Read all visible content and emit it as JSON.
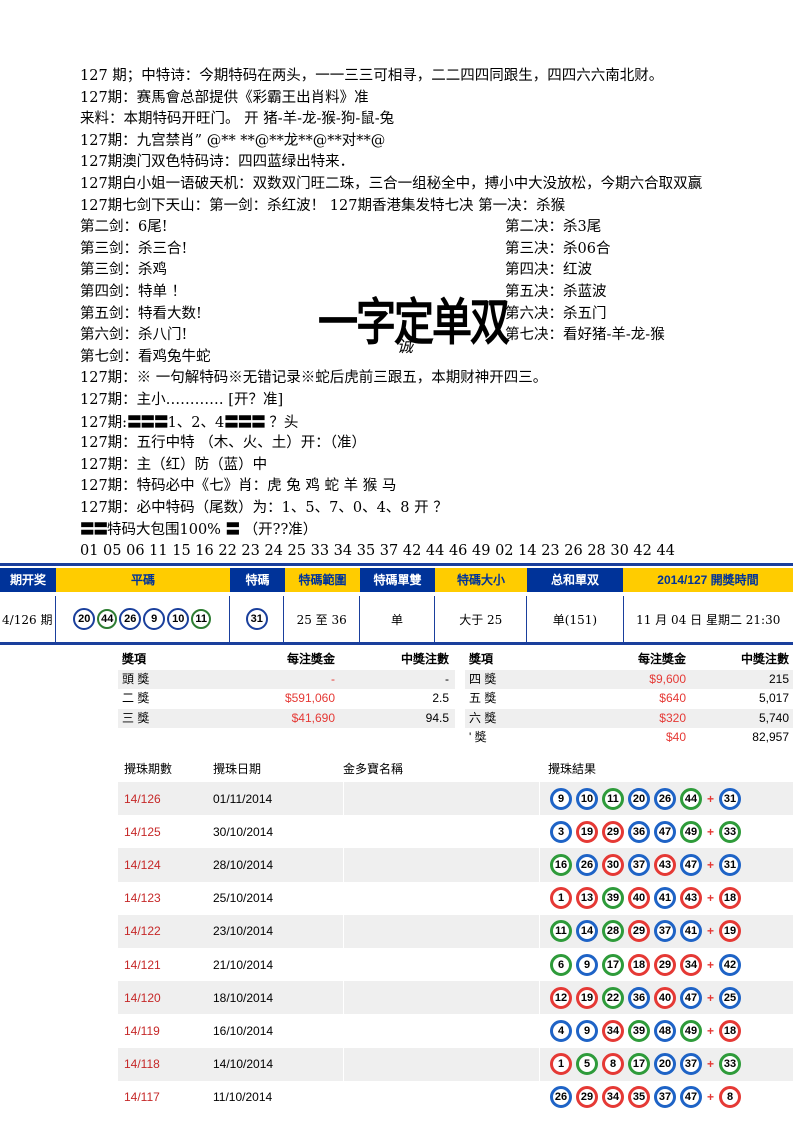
{
  "text_lines": {
    "l1": "127 期；中特诗：今期特码在两头，一一三三可相寻，二二四四同跟生，四四六六南北财。",
    "l2": "127期：赛馬會总部提供《彩霸王出肖料》准",
    "l3": "来料：本期特码开旺门。         开 猪-羊-龙-猴-狗-鼠-兔",
    "l4": "127期：九宫禁肖”  @** **@**龙**@**对**@",
    "l5": "127期澳门双色特码诗：四四蓝绿出特来．",
    "l6": "127期白小姐一语破天机：双数双门旺二珠，三合一组秘全中，搏小中大没放松，今期六合取双赢",
    "l7": "127期七剑下天山：第一剑：杀红波！        127期香港集发特七决  第一决：杀猴",
    "pairs": [
      {
        "left": "第二剑：6尾!",
        "right": "第二决：杀3尾"
      },
      {
        "left": "第三剑：杀三合!",
        "right": "第三决：杀06合"
      },
      {
        "left": "第三剑：杀鸡",
        "right": "第四决：红波"
      },
      {
        "left": "第四剑：特单 ！",
        "right": "第五决：杀蓝波"
      },
      {
        "left": "第五剑：特看大数!",
        "right": "第六决：杀五门"
      },
      {
        "left": "第六剑：杀八门!",
        "right": "第七决：看好猪-羊-龙-猴"
      }
    ],
    "l8": "第七剑：看鸡兔牛蛇",
    "l9": "127期：※ 一句解特码※无错记录※蛇后虎前三跟五，本期财神开四三。",
    "l10": "127期：主小………… [开？准]",
    "l11a": "127期:",
    "l11bars1": "〓〓〓",
    "l11b": "1、2、4",
    "l11bars2": "〓〓〓",
    "l11c": " ？头",
    "l12": "127期：五行中特   （木、火、土）开：（准）",
    "l13": "127期：主（红）防（蓝）中",
    "l14": "127期：特码必中《七》肖：虎 兔 鸡 蛇 羊 猴 马",
    "l15": "127期：必中特码（尾数）为：1、5、7、0、4、8      开 ？",
    "l16bars1": "〓〓",
    "l16a": "特码大包围100%  ",
    "l16bars2": "〓",
    "l16b": "   （开??准）",
    "l17": "01 05 06 11 15 16 22 23 24 25 33 34 35 37 42 44 46 49 02 14 23 26 28 30 42 44"
  },
  "stamp": {
    "text": "一字定单双",
    "sig": "诚"
  },
  "result_header": [
    "期开奖",
    "平碼",
    "特碼",
    "特碼範圍",
    "特碼單雙",
    "特碼大小",
    "总和單双",
    "2014/127 開獎時間"
  ],
  "result_row": {
    "period": "4/126 期",
    "balls": [
      "20",
      "44",
      "26",
      "9",
      "10",
      "11"
    ],
    "special": "31",
    "range": "25 至 36",
    "odd_even": "单",
    "size": "大于 25",
    "sum": "单(151)",
    "time": "11 月 04 日 星期二 21:30"
  },
  "prize_left": {
    "headers": [
      "獎項",
      "每注獎金",
      "中獎注數"
    ],
    "rows": [
      {
        "name": "頭 獎",
        "amount": "-",
        "count": "-"
      },
      {
        "name": "二 獎",
        "amount": "$591,060",
        "count": "2.5"
      },
      {
        "name": "三 獎",
        "amount": "$41,690",
        "count": "94.5"
      }
    ]
  },
  "prize_right": {
    "headers": [
      "獎項",
      "每注獎金",
      "中獎注數"
    ],
    "rows": [
      {
        "name": "四 獎",
        "amount": "$9,600",
        "count": "215"
      },
      {
        "name": "五 獎",
        "amount": "$640",
        "count": "5,017"
      },
      {
        "name": "六 獎",
        "amount": "$320",
        "count": "5,740"
      },
      {
        "name": "' 獎",
        "amount": "$40",
        "count": "82,957"
      }
    ]
  },
  "history": {
    "headers": [
      "攪珠期數",
      "攪珠日期",
      "金多寶名稱",
      "攪珠結果"
    ],
    "plus": "+",
    "rows": [
      {
        "period": "14/126",
        "date": "01/11/2014",
        "balls": [
          [
            "9",
            "blue"
          ],
          [
            "10",
            "blue"
          ],
          [
            "11",
            "green"
          ],
          [
            "20",
            "blue"
          ],
          [
            "26",
            "blue"
          ],
          [
            "44",
            "green"
          ]
        ],
        "special": [
          "31",
          "blue"
        ]
      },
      {
        "period": "14/125",
        "date": "30/10/2014",
        "balls": [
          [
            "3",
            "blue"
          ],
          [
            "19",
            "red"
          ],
          [
            "29",
            "red"
          ],
          [
            "36",
            "blue"
          ],
          [
            "47",
            "blue"
          ],
          [
            "49",
            "green"
          ]
        ],
        "special": [
          "33",
          "green"
        ]
      },
      {
        "period": "14/124",
        "date": "28/10/2014",
        "balls": [
          [
            "16",
            "green"
          ],
          [
            "26",
            "blue"
          ],
          [
            "30",
            "red"
          ],
          [
            "37",
            "blue"
          ],
          [
            "43",
            "red"
          ],
          [
            "47",
            "blue"
          ]
        ],
        "special": [
          "31",
          "blue"
        ]
      },
      {
        "period": "14/123",
        "date": "25/10/2014",
        "balls": [
          [
            "1",
            "red"
          ],
          [
            "13",
            "red"
          ],
          [
            "39",
            "green"
          ],
          [
            "40",
            "red"
          ],
          [
            "41",
            "blue"
          ],
          [
            "43",
            "red"
          ]
        ],
        "special": [
          "18",
          "red"
        ]
      },
      {
        "period": "14/122",
        "date": "23/10/2014",
        "balls": [
          [
            "11",
            "green"
          ],
          [
            "14",
            "blue"
          ],
          [
            "28",
            "green"
          ],
          [
            "29",
            "red"
          ],
          [
            "37",
            "blue"
          ],
          [
            "41",
            "blue"
          ]
        ],
        "special": [
          "19",
          "red"
        ]
      },
      {
        "period": "14/121",
        "date": "21/10/2014",
        "balls": [
          [
            "6",
            "green"
          ],
          [
            "9",
            "blue"
          ],
          [
            "17",
            "green"
          ],
          [
            "18",
            "red"
          ],
          [
            "29",
            "red"
          ],
          [
            "34",
            "red"
          ]
        ],
        "special": [
          "42",
          "blue"
        ]
      },
      {
        "period": "14/120",
        "date": "18/10/2014",
        "balls": [
          [
            "12",
            "red"
          ],
          [
            "19",
            "red"
          ],
          [
            "22",
            "green"
          ],
          [
            "36",
            "blue"
          ],
          [
            "40",
            "red"
          ],
          [
            "47",
            "blue"
          ]
        ],
        "special": [
          "25",
          "blue"
        ]
      },
      {
        "period": "14/119",
        "date": "16/10/2014",
        "balls": [
          [
            "4",
            "blue"
          ],
          [
            "9",
            "blue"
          ],
          [
            "34",
            "red"
          ],
          [
            "39",
            "green"
          ],
          [
            "48",
            "blue"
          ],
          [
            "49",
            "green"
          ]
        ],
        "special": [
          "18",
          "red"
        ]
      },
      {
        "period": "14/118",
        "date": "14/10/2014",
        "balls": [
          [
            "1",
            "red"
          ],
          [
            "5",
            "green"
          ],
          [
            "8",
            "red"
          ],
          [
            "17",
            "green"
          ],
          [
            "20",
            "blue"
          ],
          [
            "37",
            "blue"
          ]
        ],
        "special": [
          "33",
          "green"
        ]
      },
      {
        "period": "14/117",
        "date": "11/10/2014",
        "balls": [
          [
            "26",
            "blue"
          ],
          [
            "29",
            "red"
          ],
          [
            "34",
            "red"
          ],
          [
            "35",
            "red"
          ],
          [
            "37",
            "blue"
          ],
          [
            "47",
            "blue"
          ]
        ],
        "special": [
          "8",
          "red"
        ]
      }
    ]
  }
}
